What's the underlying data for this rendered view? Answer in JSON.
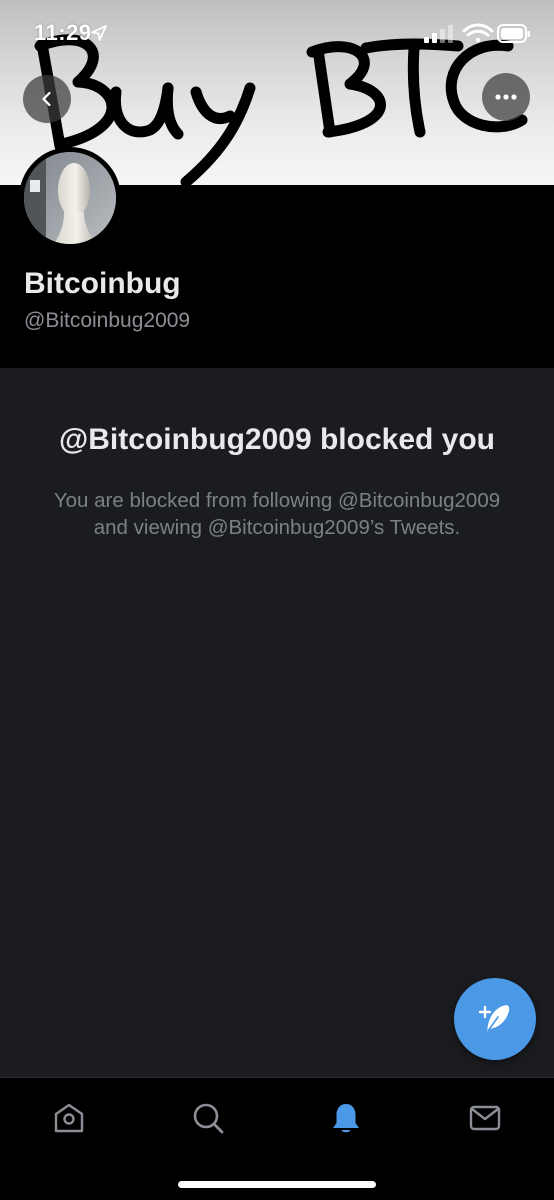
{
  "status_bar": {
    "time": "11:29"
  },
  "banner": {
    "handwriting": "Buy BTC"
  },
  "header": {
    "back_icon": "chevron-left-icon",
    "more_icon": "ellipsis-icon"
  },
  "profile": {
    "display_name": "Bitcoinbug",
    "handle": "@Bitcoinbug2009"
  },
  "blocked": {
    "title": "@Bitcoinbug2009 blocked you",
    "description": "You are blocked from following @Bitcoinbug2009 and viewing @Bitcoinbug2009’s Tweets."
  },
  "fab": {
    "icon": "compose-tweet-icon"
  },
  "bottom_nav": {
    "items": [
      {
        "icon": "home-icon",
        "active": false
      },
      {
        "icon": "search-icon",
        "active": false
      },
      {
        "icon": "notifications-bell-icon",
        "active": true
      },
      {
        "icon": "messages-envelope-icon",
        "active": false
      }
    ]
  },
  "colors": {
    "accent": "#4a98e6",
    "background": "#1b1c20",
    "header_black": "#000000",
    "primary_text": "#e7e9ea",
    "secondary_text": "#7b8087"
  }
}
